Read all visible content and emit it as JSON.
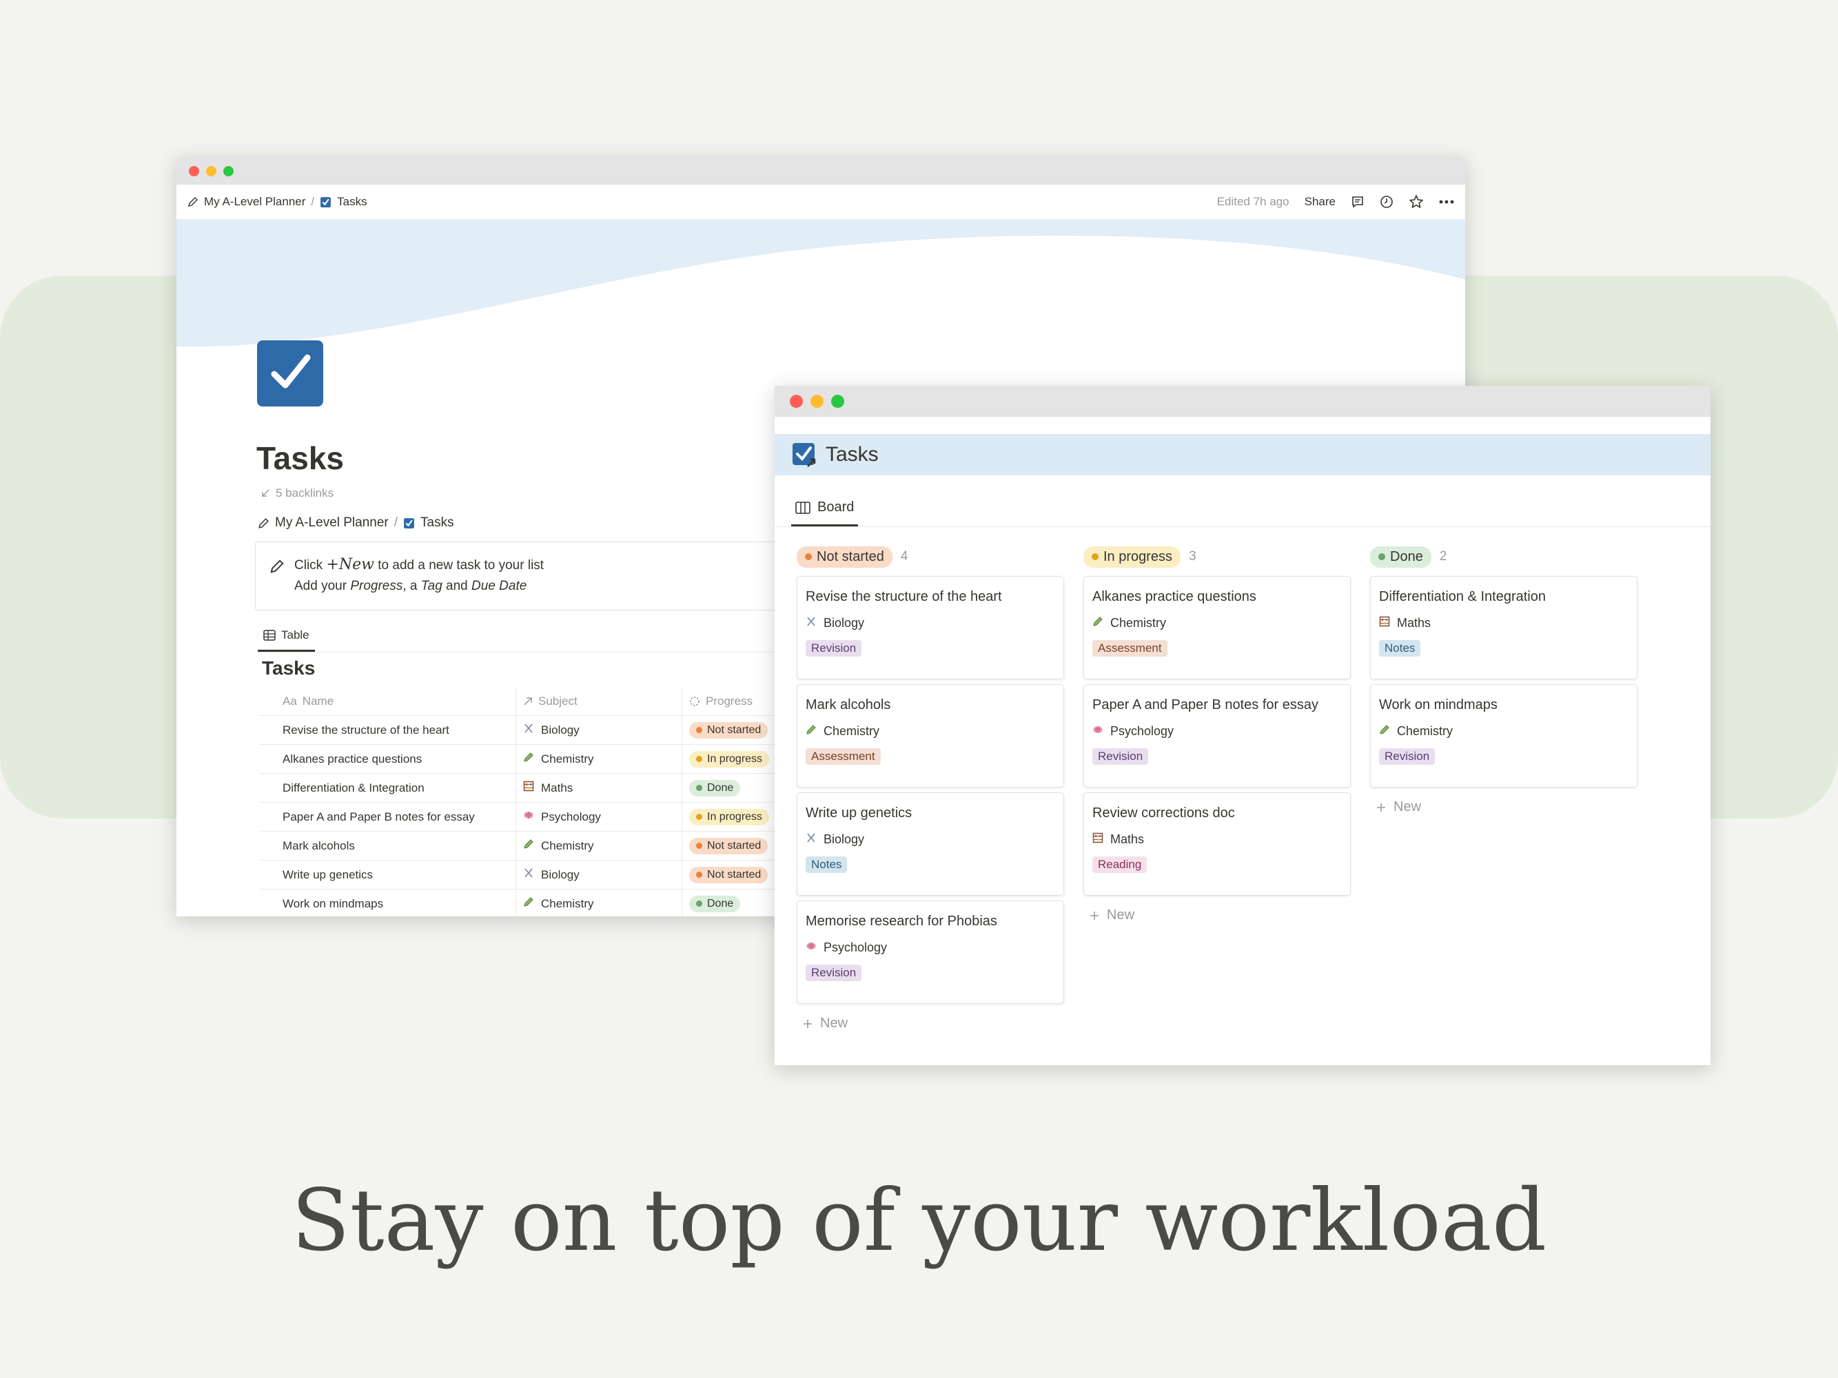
{
  "colors": {
    "not_started_bg": "#fadbc7",
    "not_started_dot": "#e8833a",
    "in_progress_bg": "#fbeec3",
    "in_progress_dot": "#e3a21a",
    "done_bg": "#dbeddb",
    "done_dot": "#6aa36d",
    "revision_bg": "#e8deee",
    "revision_fg": "#5a3d72",
    "assessment_bg": "#f4dfd5",
    "assessment_fg": "#7a3f25",
    "notes_bg": "#d3e5ef",
    "notes_fg": "#2f5c78",
    "reading_bg": "#f5e0e9",
    "reading_fg": "#8a2f57"
  },
  "headline": "Stay on top of your workload",
  "table_window": {
    "breadcrumb": {
      "root": "My A-Level Planner",
      "sep": "/",
      "page": "Tasks"
    },
    "edited": "Edited 7h ago",
    "share": "Share",
    "title": "Tasks",
    "backlinks": "5 backlinks",
    "page_breadcrumb": {
      "root": "My A-Level Planner",
      "sep": "/",
      "page": "Tasks"
    },
    "callout": {
      "line1_pre": "Click",
      "new_word": "+New",
      "line1_post": "to add a new task to your list",
      "line2_a": "Add your",
      "line2_progress": "Progress",
      "line2_b": ", a",
      "line2_tag": "Tag",
      "line2_c": "and",
      "line2_due": "Due Date"
    },
    "view_tab": "Table",
    "table_title": "Tasks",
    "columns": {
      "name_prefix": "Aa",
      "name": "Name",
      "subject": "Subject",
      "progress": "Progress"
    },
    "rows": [
      {
        "name": "Revise the structure of the heart",
        "subject": "Biology",
        "subject_icon": "dna-icon",
        "progress": "Not started",
        "status": "not_started"
      },
      {
        "name": "Alkanes practice questions",
        "subject": "Chemistry",
        "subject_icon": "pencil-icon",
        "progress": "In progress",
        "status": "in_progress"
      },
      {
        "name": "Differentiation & Integration",
        "subject": "Maths",
        "subject_icon": "abacus-icon",
        "progress": "Done",
        "status": "done"
      },
      {
        "name": "Paper A and Paper B notes for essay",
        "subject": "Psychology",
        "subject_icon": "brain-icon",
        "progress": "In progress",
        "status": "in_progress"
      },
      {
        "name": "Mark alcohols",
        "subject": "Chemistry",
        "subject_icon": "pencil-icon",
        "progress": "Not started",
        "status": "not_started"
      },
      {
        "name": "Write up genetics",
        "subject": "Biology",
        "subject_icon": "dna-icon",
        "progress": "Not started",
        "status": "not_started"
      },
      {
        "name": "Work on mindmaps",
        "subject": "Chemistry",
        "subject_icon": "pencil-icon",
        "progress": "Done",
        "status": "done"
      }
    ]
  },
  "board_window": {
    "title": "Tasks",
    "view_tab": "Board",
    "new_label": "New",
    "columns": [
      {
        "label": "Not started",
        "count": "4",
        "status": "not_started",
        "cards": [
          {
            "title": "Revise the structure of the heart",
            "subject": "Biology",
            "subject_icon": "dna-icon",
            "tag": "Revision",
            "tag_kind": "revision"
          },
          {
            "title": "Mark alcohols",
            "subject": "Chemistry",
            "subject_icon": "pencil-icon",
            "tag": "Assessment",
            "tag_kind": "assessment"
          },
          {
            "title": "Write up genetics",
            "subject": "Biology",
            "subject_icon": "dna-icon",
            "tag": "Notes",
            "tag_kind": "notes"
          },
          {
            "title": "Memorise research for Phobias",
            "subject": "Psychology",
            "subject_icon": "brain-icon",
            "tag": "Revision",
            "tag_kind": "revision"
          }
        ]
      },
      {
        "label": "In progress",
        "count": "3",
        "status": "in_progress",
        "cards": [
          {
            "title": "Alkanes practice questions",
            "subject": "Chemistry",
            "subject_icon": "pencil-icon",
            "tag": "Assessment",
            "tag_kind": "assessment"
          },
          {
            "title": "Paper A and Paper B notes for essay",
            "subject": "Psychology",
            "subject_icon": "brain-icon",
            "tag": "Revision",
            "tag_kind": "revision"
          },
          {
            "title": "Review corrections doc",
            "subject": "Maths",
            "subject_icon": "abacus-icon",
            "tag": "Reading",
            "tag_kind": "reading"
          }
        ]
      },
      {
        "label": "Done",
        "count": "2",
        "status": "done",
        "cards": [
          {
            "title": "Differentiation & Integration",
            "subject": "Maths",
            "subject_icon": "abacus-icon",
            "tag": "Notes",
            "tag_kind": "notes"
          },
          {
            "title": "Work on mindmaps",
            "subject": "Chemistry",
            "subject_icon": "pencil-icon",
            "tag": "Revision",
            "tag_kind": "revision"
          }
        ]
      }
    ]
  }
}
